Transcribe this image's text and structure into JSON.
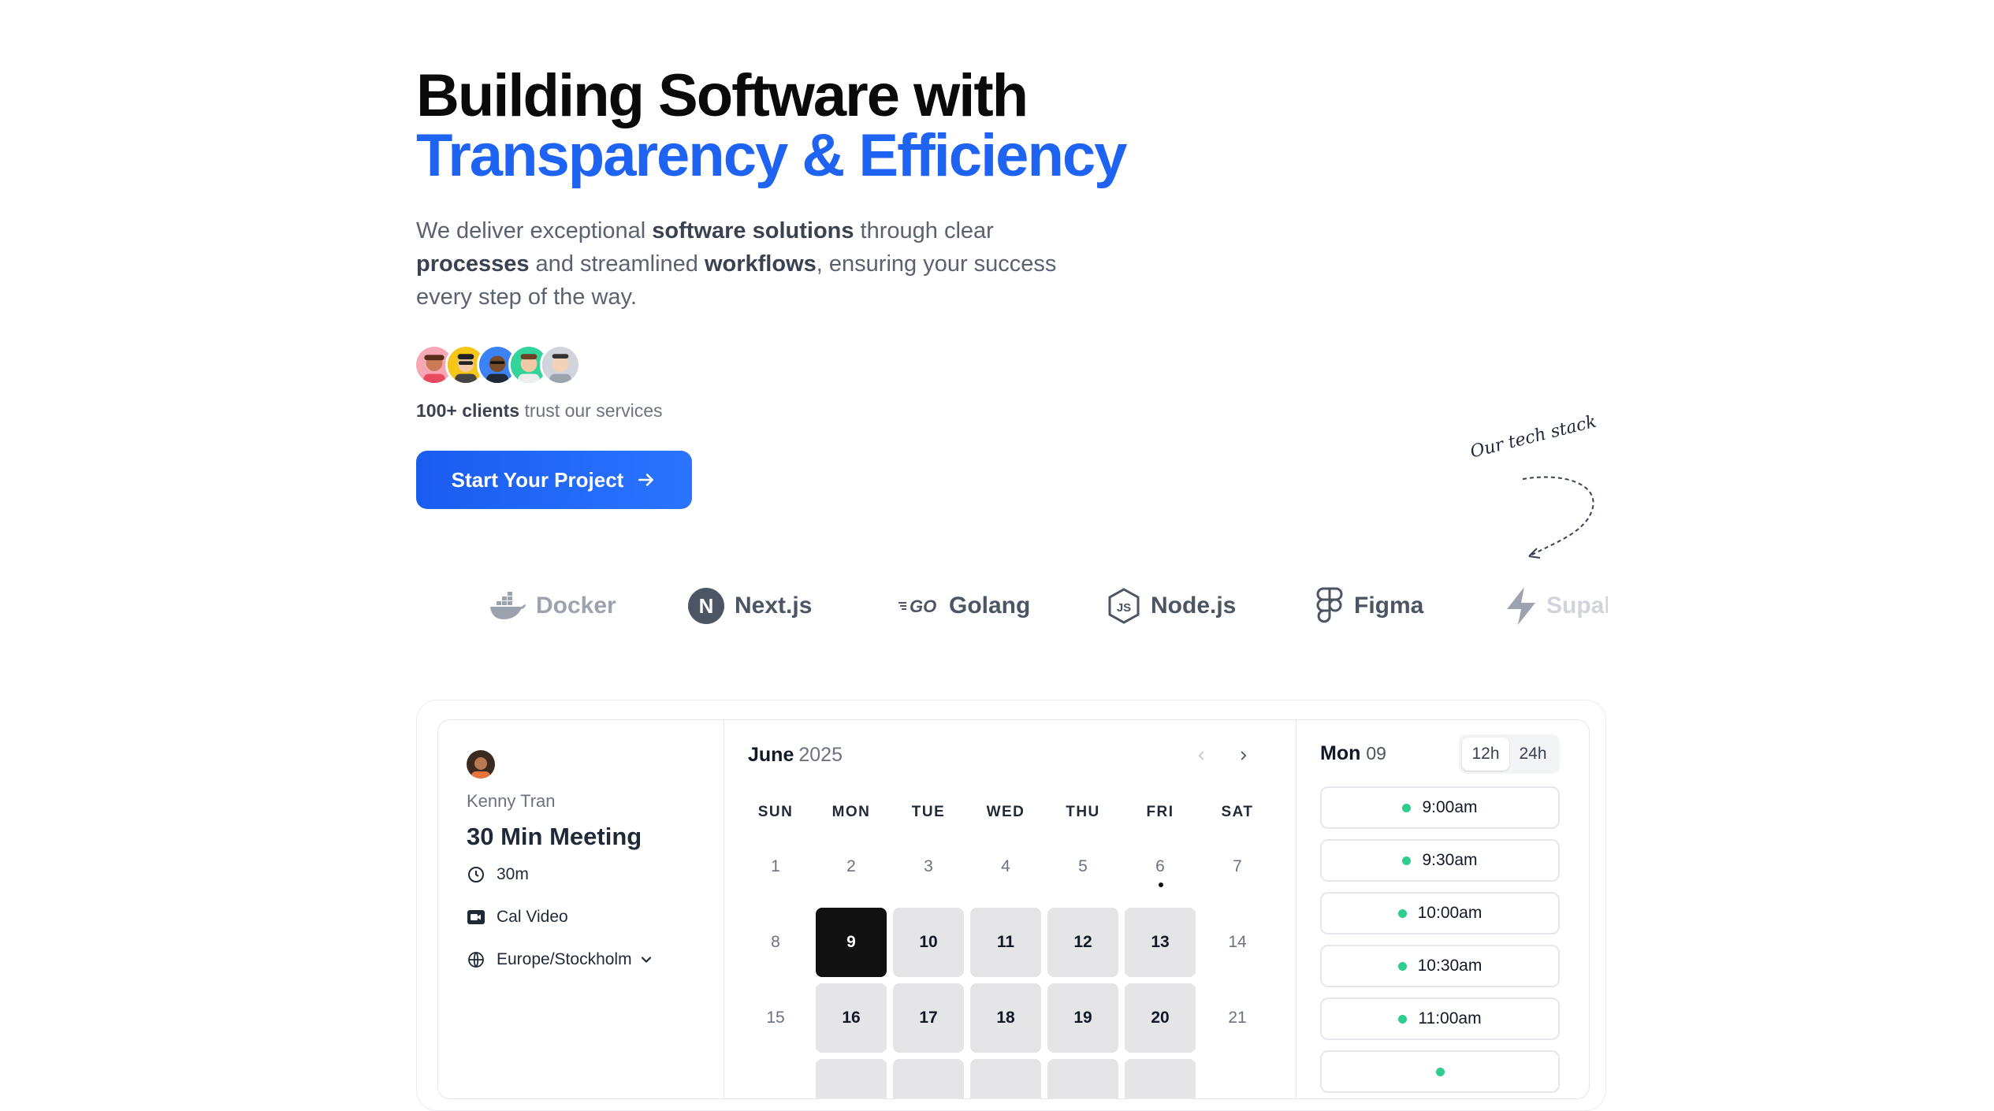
{
  "hero": {
    "title_line1": "Building Software with",
    "title_line2": "Transparency & Efficiency",
    "lead_1": "We deliver exceptional ",
    "lead_b1": "software solutions",
    "lead_2": " through clear ",
    "lead_b2": "processes",
    "lead_3": " and streamlined ",
    "lead_b3": "workflows",
    "lead_4": ", ensuring your success every step of the way.",
    "clients_bold": "100+ clients",
    "clients_rest": " trust our services",
    "cta_label": "Start Your Project"
  },
  "tech": {
    "note": "Our tech stack",
    "logos": [
      "Docker",
      "Next.js",
      "Golang",
      "Node.js",
      "Figma",
      "Supabase"
    ]
  },
  "booking": {
    "host": "Kenny Tran",
    "event_title": "30 Min Meeting",
    "duration": "30m",
    "location": "Cal Video",
    "timezone": "Europe/Stockholm",
    "month": "June",
    "year": "2025",
    "weekdays": [
      "SUN",
      "MON",
      "TUE",
      "WED",
      "THU",
      "FRI",
      "SAT"
    ],
    "week1": [
      "1",
      "2",
      "3",
      "4",
      "5",
      "6",
      "7"
    ],
    "week2": [
      "8",
      "9",
      "10",
      "11",
      "12",
      "13",
      "14"
    ],
    "week3": [
      "15",
      "16",
      "17",
      "18",
      "19",
      "20",
      "21"
    ],
    "selected_day_label": "Mon",
    "selected_day_num": "09",
    "format_12": "12h",
    "format_24": "24h",
    "slots": [
      "9:00am",
      "9:30am",
      "10:00am",
      "10:30am",
      "11:00am"
    ]
  },
  "colors": {
    "accent": "#1f63f2",
    "slot_dot": "#2ecc8e",
    "selected_day": "#111111"
  }
}
